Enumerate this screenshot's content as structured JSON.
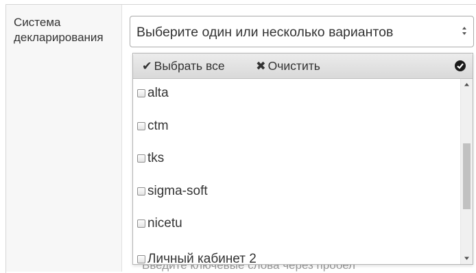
{
  "field": {
    "label": "Система декларирования",
    "select_placeholder": "Выберите один или несколько вариантов",
    "hint": "Введите ключевые слова через пробел"
  },
  "dropdown": {
    "select_all_label": "Выбрать все",
    "clear_label": "Очистить",
    "options": [
      {
        "label": "alta",
        "checked": false
      },
      {
        "label": "ctm",
        "checked": false
      },
      {
        "label": "tks",
        "checked": false
      },
      {
        "label": "sigma-soft",
        "checked": false
      },
      {
        "label": "nicetu",
        "checked": false
      },
      {
        "label": "Личный кабинет 2",
        "checked": false
      }
    ],
    "scroll_position": 0.55
  },
  "icons": {
    "select_all": "checkmark-icon",
    "clear": "x-icon",
    "close": "circle-check-icon",
    "caret": "up-down-caret-icon"
  }
}
